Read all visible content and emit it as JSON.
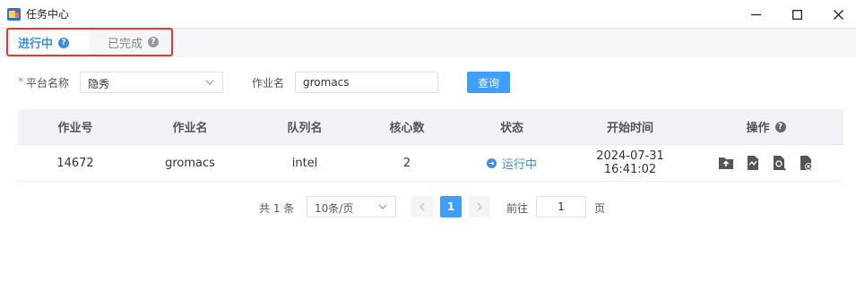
{
  "window": {
    "title": "任务中心"
  },
  "tabs": [
    {
      "label": "进行中",
      "active": true
    },
    {
      "label": "已完成",
      "active": false
    }
  ],
  "filter": {
    "required_mark": "*",
    "platform_label": "平台名称",
    "platform_value": "隐秀",
    "job_name_label": "作业名",
    "job_name_value": "gromacs",
    "query_button": "查询"
  },
  "table": {
    "columns": [
      "作业号",
      "作业名",
      "队列名",
      "核心数",
      "状态",
      "开始时间",
      "操作"
    ],
    "rows": [
      {
        "job_id": "14672",
        "job_name": "gromacs",
        "queue": "intel",
        "cores": "2",
        "status": "运行中",
        "start_time": "2024-07-31 16:41:02"
      }
    ],
    "operation_icons": [
      "upload-folder-icon",
      "file-edit-icon",
      "file-search-icon",
      "file-delete-icon"
    ]
  },
  "pagination": {
    "total_text": "共 1 条",
    "page_size": "10条/页",
    "current_page": "1",
    "goto_label": "前往",
    "goto_value": "1",
    "page_suffix": "页"
  },
  "colors": {
    "accent": "#409eff",
    "active_tab": "#3a8ee6",
    "highlight_border": "#e53935",
    "required": "#f56c6c"
  }
}
